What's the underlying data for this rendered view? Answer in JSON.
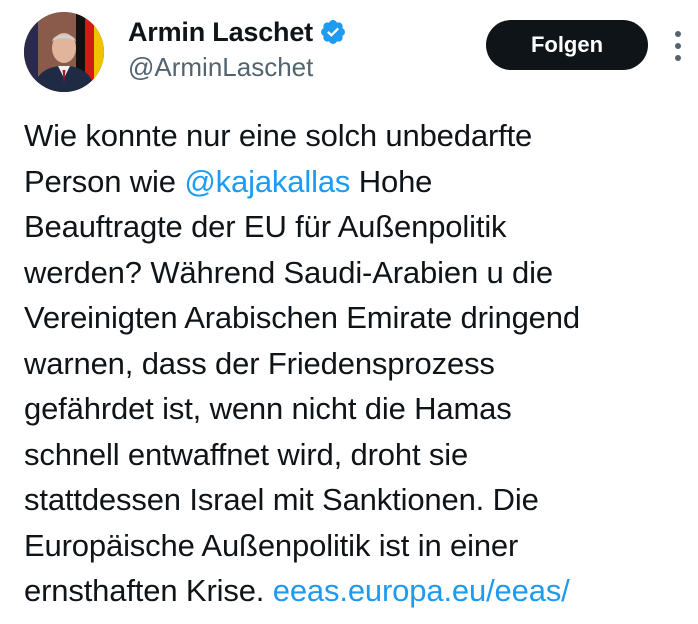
{
  "author": {
    "display_name": "Armin Laschet",
    "handle": "@ArminLaschet",
    "verified_icon": "verified-badge-icon",
    "verified_color": "#1d9bf0"
  },
  "follow_button": {
    "label": "Folgen",
    "bg_color": "#0f1419",
    "text_color": "#ffffff"
  },
  "more_icon": "more-vertical-icon",
  "tweet": {
    "lines": [
      [
        {
          "text": "Wie konnte nur eine solch unbedarfte",
          "type": "text"
        }
      ],
      [
        {
          "text": "Person wie ",
          "type": "text"
        },
        {
          "text": "@kajakallas",
          "type": "mention"
        },
        {
          "text": " Hohe",
          "type": "text"
        }
      ],
      [
        {
          "text": "Beauftragte der EU für Außenpolitik",
          "type": "text"
        }
      ],
      [
        {
          "text": "werden? Während Saudi-Arabien u die",
          "type": "text"
        }
      ],
      [
        {
          "text": "Vereinigten Arabischen Emirate dringend",
          "type": "text"
        }
      ],
      [
        {
          "text": "warnen, dass der Friedensprozess",
          "type": "text"
        }
      ],
      [
        {
          "text": "gefährdet ist, wenn nicht die Hamas",
          "type": "text"
        }
      ],
      [
        {
          "text": "schnell entwaffnet wird, droht sie",
          "type": "text"
        }
      ],
      [
        {
          "text": "stattdessen Israel mit Sanktionen. Die",
          "type": "text"
        }
      ],
      [
        {
          "text": "Europäische Außenpolitik ist in einer",
          "type": "text"
        }
      ],
      [
        {
          "text": "ernsthaften Krise. ",
          "type": "text"
        },
        {
          "text": "eeas.europa.eu/eeas/",
          "type": "link"
        }
      ]
    ],
    "link_color": "#1d9bf0",
    "text_color": "#0f1419"
  }
}
